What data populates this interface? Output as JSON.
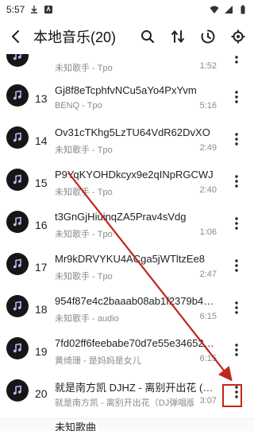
{
  "status_bar": {
    "time": "5:57"
  },
  "header": {
    "title": "本地音乐(20)"
  },
  "songs": [
    {
      "num": "",
      "title": "",
      "artist": "未知歌手 - Tpo",
      "duration": "1:52"
    },
    {
      "num": "13",
      "title": "Gj8f8eTcphfvNCu5aYo4PxYvm",
      "artist": "BENQ - Tpo",
      "duration": "5:16"
    },
    {
      "num": "14",
      "title": "Ov31cTKhg5LzTU64VdR62DvXO",
      "artist": "未知歌手 - Tpo",
      "duration": "2:49"
    },
    {
      "num": "15",
      "title": "P9YqKYOHDkcyx9e2qINpRGCWJ",
      "artist": "未知歌手 - Tpo",
      "duration": "2:40"
    },
    {
      "num": "16",
      "title": "t3GnGjHiuinqZA5Prav4sVdg",
      "artist": "未知歌手 - Tpo",
      "duration": "1:06"
    },
    {
      "num": "17",
      "title": "Mr9kDRVYKU4ACga5jWTltzEe8",
      "artist": "未知歌手 - Tpo",
      "duration": "2:47"
    },
    {
      "num": "18",
      "title": "954f87e4c2baaab08ab1f2379b45...",
      "artist": "未知歌手 - audio",
      "duration": "6:15"
    },
    {
      "num": "19",
      "title": "7fd02ff6feebabe70d7e55e34652a...",
      "artist": "黄绮珊 - 是妈妈是女儿",
      "duration": "6:15"
    },
    {
      "num": "20",
      "title": "就是南方凯 DJHZ - 离别开出花 (DJ...",
      "artist": "就是南方凯 - 离别开出花（DJ弹唱版）",
      "duration": "3:07"
    }
  ],
  "bottom": {
    "label": "未知歌曲"
  },
  "colors": {
    "highlight": "#c0271c",
    "avatar_bg": "#161616"
  }
}
